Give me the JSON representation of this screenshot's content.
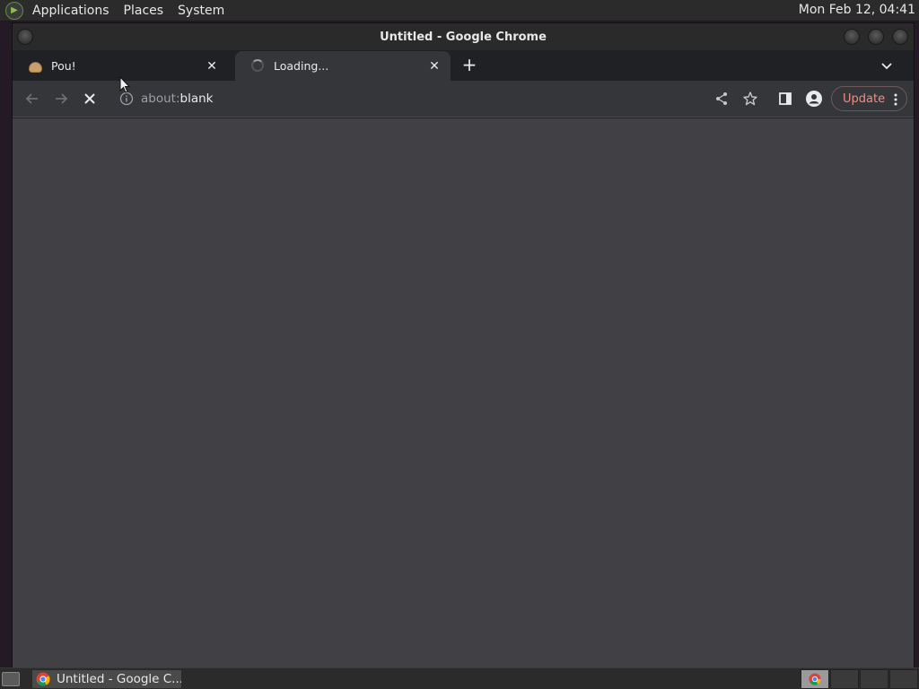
{
  "top_panel": {
    "menus": [
      "Applications",
      "Places",
      "System"
    ],
    "clock": "Mon Feb 12, 04:41"
  },
  "window": {
    "title": "Untitled - Google Chrome"
  },
  "tabs": [
    {
      "title": "Pou!",
      "favicon": "pou-icon",
      "state": "inactive"
    },
    {
      "title": "Loading...",
      "favicon": "loading-spinner-icon",
      "state": "active"
    }
  ],
  "toolbar": {
    "url_scheme": "about:",
    "url_host": "blank",
    "update_label": "Update"
  },
  "taskbar": {
    "task_label": "Untitled - Google C..."
  },
  "colors": {
    "content_bg": "#414145",
    "toolbar_bg": "#35363a",
    "update_accent": "#f28b82"
  }
}
